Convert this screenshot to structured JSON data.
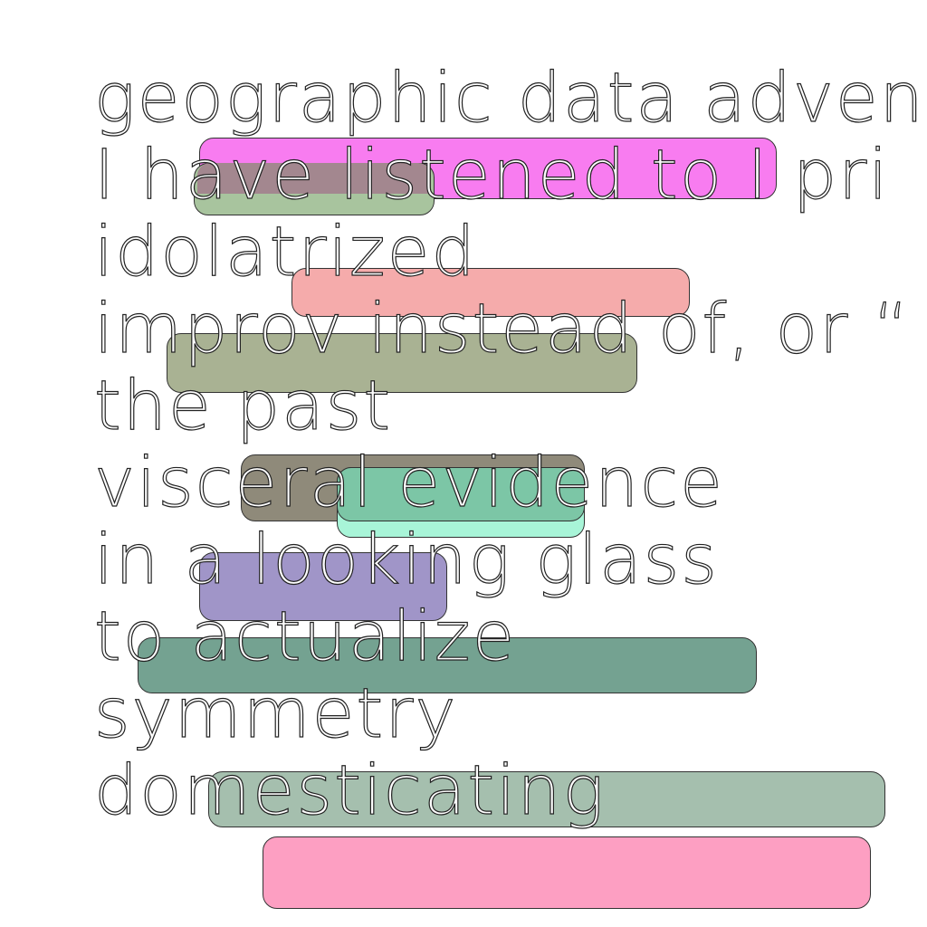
{
  "lines": [
    "geographic data adven",
    "I have listened to I pri",
    "idolatrized",
    "improv instead of, or “",
    "the past",
    "visceral evidence",
    "in a looking glass",
    "to actualize",
    "symmetry",
    "domesticating"
  ],
  "bar_colors": {
    "magenta": "#f87cf0",
    "sage_small": "#a8c49e",
    "mauve": "#a3878f",
    "salmon": "#f5abab",
    "olive": "#a9b293",
    "taupe": "#8f8a7a",
    "jade": "#7cc6a6",
    "mint": "#a8f5d8",
    "lavender": "#a095c8",
    "teal": "#74a291",
    "pale_sage": "#a5bfae",
    "pink": "#fd9fc2"
  }
}
